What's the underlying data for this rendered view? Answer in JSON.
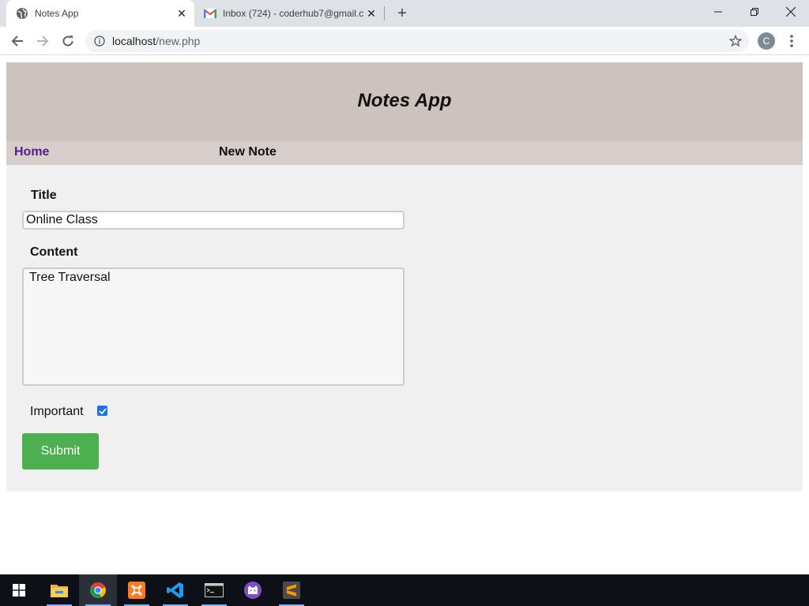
{
  "browser": {
    "tabs": [
      {
        "title": "Notes App",
        "icon": "globe-icon",
        "active": true
      },
      {
        "title": "Inbox (724) - coderhub7@gmail.c",
        "icon": "gmail-icon",
        "active": false
      }
    ],
    "address": {
      "host": "localhost",
      "path": "/new.php"
    },
    "profile_initial": "C"
  },
  "app": {
    "title": "Notes App",
    "nav": {
      "home_label": "Home",
      "current_label": "New Note"
    }
  },
  "form": {
    "title_label": "Title",
    "title_value": "Online Class",
    "content_label": "Content",
    "content_value": "Tree Traversal",
    "important_label": "Important",
    "important_checked": true,
    "submit_label": "Submit"
  },
  "taskbar": {
    "items": [
      "windows-start-icon",
      "file-explorer-icon",
      "chrome-icon",
      "xampp-icon",
      "vscode-icon",
      "terminal-icon",
      "github-desktop-icon",
      "sublime-text-icon"
    ],
    "active": "chrome-icon"
  },
  "colors": {
    "header_bg": "#cec2bf",
    "nav_bg": "#d7cdcb",
    "form_bg": "#f0f0f0",
    "submit_bg": "#4caf50",
    "link_visited": "#551a8b"
  }
}
